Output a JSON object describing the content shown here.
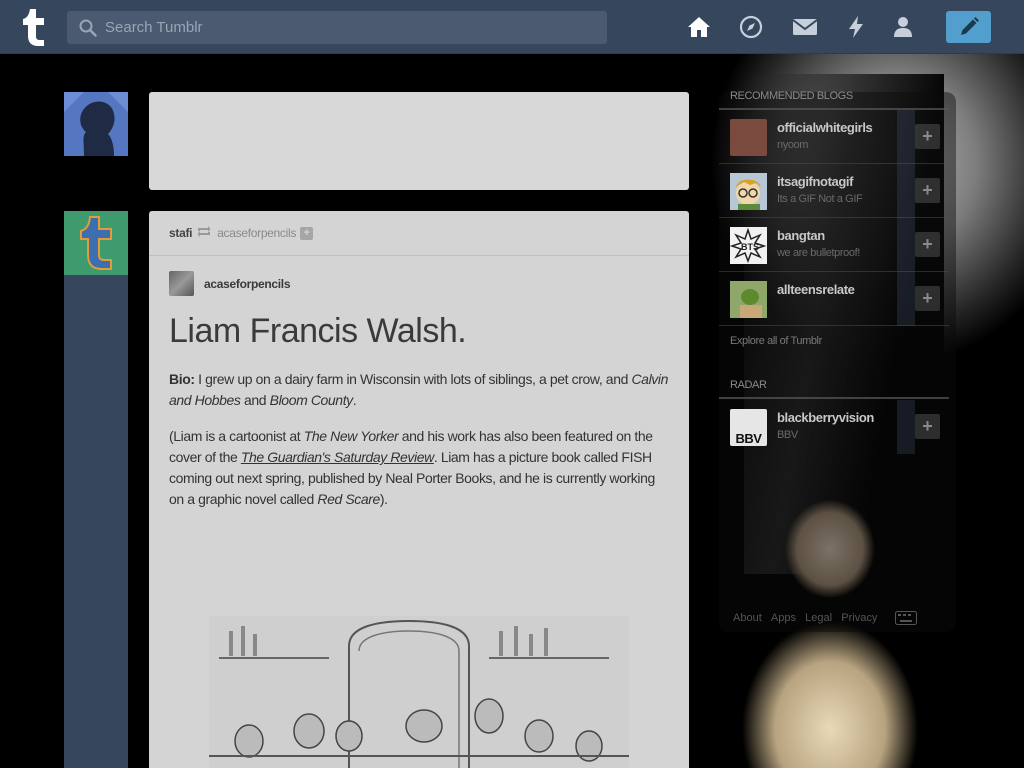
{
  "header": {
    "search_placeholder": "Search Tumblr",
    "icons": [
      "home-icon",
      "explore-icon",
      "inbox-icon",
      "activity-icon",
      "account-icon",
      "compose-icon"
    ]
  },
  "post": {
    "reblogger": "stafi",
    "source_user": "acaseforpencils",
    "source_label": "acaseforpencils",
    "title": "Liam Francis Walsh.",
    "bio_label": "Bio:",
    "bio_text_1": " I grew up on a dairy farm in Wisconsin with lots of siblings, a pet crow, and ",
    "bio_em_1": "Calvin and Hobbes",
    "bio_text_2": " and ",
    "bio_em_2": "Bloom County",
    "bio_text_3": ".",
    "p2_text_1": "(Liam is a cartoonist at ",
    "p2_em_1": "The New Yorker",
    "p2_text_2": " and his work has also been featured on the cover of the ",
    "p2_link": "The Guardian's Saturday Review",
    "p2_text_3": ". Liam has a picture book called FISH coming out next spring, published by Neal Porter Books, and he is currently working on a graphic novel called ",
    "p2_em_2": "Red Scare",
    "p2_text_4": ")."
  },
  "sidebar": {
    "recommended_title": "RECOMMENDED BLOGS",
    "blogs": [
      {
        "name": "officialwhitegirls",
        "subtitle": "nyoom",
        "avatar_color": "#8a5a4a"
      },
      {
        "name": "itsagifnotagif",
        "subtitle": "Its a GIF Not a GIF",
        "avatar_color": "#c9a34a"
      },
      {
        "name": "bangtan",
        "subtitle": "we are bulletproof!",
        "avatar_color": "#e8e8e8"
      },
      {
        "name": "allteensrelate",
        "subtitle": "",
        "avatar_color": "#6a8a4a"
      }
    ],
    "explore_label": "Explore all of Tumblr",
    "radar_title": "RADAR",
    "radar": {
      "name": "blackberryvision",
      "subtitle": "BBV",
      "avatar_text": "BBV"
    },
    "footer_about": "About",
    "footer_apps": "Apps",
    "footer_legal": "Legal",
    "footer_privacy": "Privacy"
  },
  "colors": {
    "header_bg": "#36465d",
    "compose_accent": "#529ecc",
    "post_bg": "#d4d4d4"
  }
}
